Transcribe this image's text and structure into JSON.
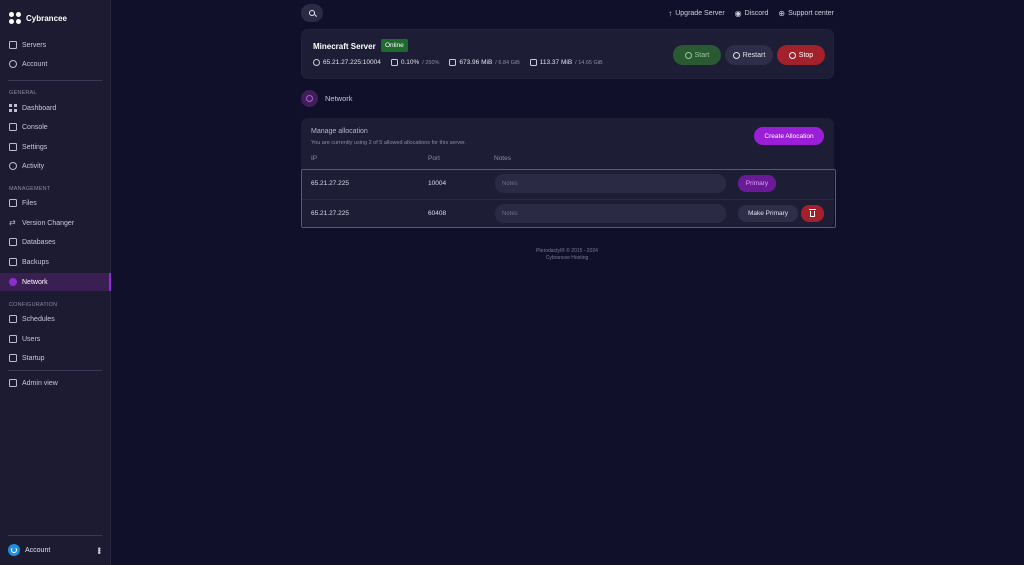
{
  "sidebar": {
    "brand": "Cybrancee",
    "top_items": [
      {
        "label": "Servers",
        "icon": "server-icon"
      },
      {
        "label": "Account",
        "icon": "account-icon"
      }
    ],
    "sections": [
      {
        "label": "GENERAL",
        "items": [
          {
            "label": "Dashboard",
            "icon": "dashboard-icon"
          },
          {
            "label": "Console",
            "icon": "console-icon"
          },
          {
            "label": "Settings",
            "icon": "settings-icon"
          },
          {
            "label": "Activity",
            "icon": "activity-icon"
          }
        ]
      },
      {
        "label": "MANAGEMENT",
        "items": [
          {
            "label": "Files",
            "icon": "files-icon"
          },
          {
            "label": "Version Changer",
            "icon": "version-icon"
          },
          {
            "label": "Databases",
            "icon": "database-icon"
          },
          {
            "label": "Backups",
            "icon": "backup-icon"
          },
          {
            "label": "Network",
            "icon": "network-icon",
            "active": true
          }
        ]
      },
      {
        "label": "CONFIGURATION",
        "items": [
          {
            "label": "Schedules",
            "icon": "schedule-icon"
          },
          {
            "label": "Users",
            "icon": "users-icon"
          },
          {
            "label": "Startup",
            "icon": "startup-icon"
          }
        ]
      }
    ],
    "admin_view": "Admin view",
    "footer_account": "Account"
  },
  "topbar": {
    "links": [
      {
        "label": "Upgrade Server",
        "icon": "arrow-up-icon"
      },
      {
        "label": "Discord",
        "icon": "discord-icon"
      },
      {
        "label": "Support center",
        "icon": "support-icon"
      }
    ]
  },
  "server": {
    "name": "Minecraft Server",
    "status": "Online",
    "address": "65.21.27.225:10004",
    "cpu": "0.10%",
    "cpu_limit": "/ 250%",
    "memory": "673.96 MiB",
    "memory_limit": "/ 6.84 GiB",
    "disk": "113.37 MiB",
    "disk_limit": "/ 14.65 GiB",
    "buttons": {
      "start": "Start",
      "restart": "Restart",
      "stop": "Stop"
    }
  },
  "network": {
    "heading": "Network",
    "manage_title": "Manage allocation",
    "manage_sub": "You are currently using 2 of 5 allowed allocations for this server.",
    "create_button": "Create Allocation",
    "columns": {
      "ip": "IP",
      "port": "Port",
      "notes": "Notes"
    },
    "notes_placeholder": "Notes",
    "rows": [
      {
        "ip": "65.21.27.225",
        "port": "10004",
        "action": "Primary"
      },
      {
        "ip": "65.21.27.225",
        "port": "60408",
        "action": "Make Primary"
      }
    ]
  },
  "footer": {
    "line1": "Pterodactyl® © 2015 - 2024",
    "line2": "Cybrancee Hosting"
  },
  "colors": {
    "background": "#11102a",
    "sidebar": "#1c1b31",
    "accent": "#9b1ed8",
    "online": "#1f6b2e",
    "stop": "#a3212b"
  }
}
